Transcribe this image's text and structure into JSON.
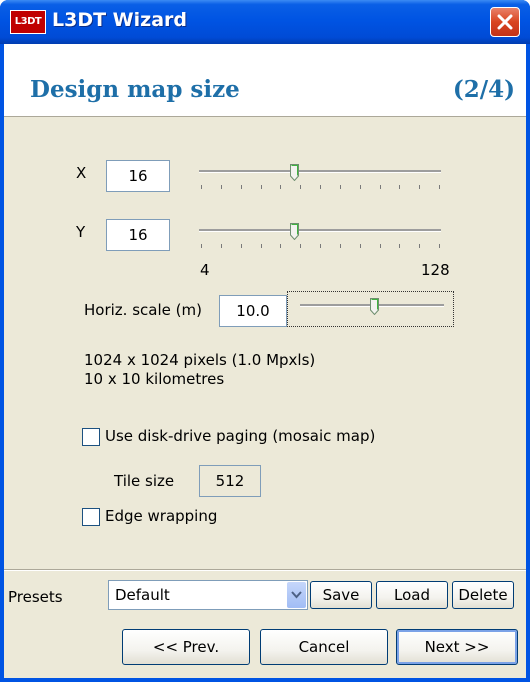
{
  "window": {
    "title": "L3DT Wizard",
    "app_icon_text": "L3DT",
    "close_icon": "close-icon"
  },
  "header": {
    "title": "Design map size",
    "step": "(2/4)"
  },
  "size": {
    "x_label": "X",
    "x_value": "16",
    "y_label": "Y",
    "y_value": "16",
    "slider_min_label": "4",
    "slider_max_label": "128"
  },
  "scale": {
    "label": "Horiz. scale (m)",
    "value": "10.0"
  },
  "info": {
    "pixels": "1024 x 1024 pixels (1.0 Mpxls)",
    "distance": "10 x 10 kilometres"
  },
  "options": {
    "paging_label": "Use disk-drive paging (mosaic map)",
    "paging_checked": false,
    "tile_size_label": "Tile size",
    "tile_size_value": "512",
    "wrapping_label": "Edge wrapping",
    "wrapping_checked": false
  },
  "presets": {
    "label": "Presets",
    "selected": "Default",
    "save_label": "Save",
    "load_label": "Load",
    "delete_label": "Delete"
  },
  "nav": {
    "prev_label": "<< Prev.",
    "cancel_label": "Cancel",
    "next_label": "Next >>"
  },
  "colors": {
    "titlebar": "#0054e3",
    "heading": "#1e6fa8",
    "dialog_bg": "#ece9d8"
  }
}
